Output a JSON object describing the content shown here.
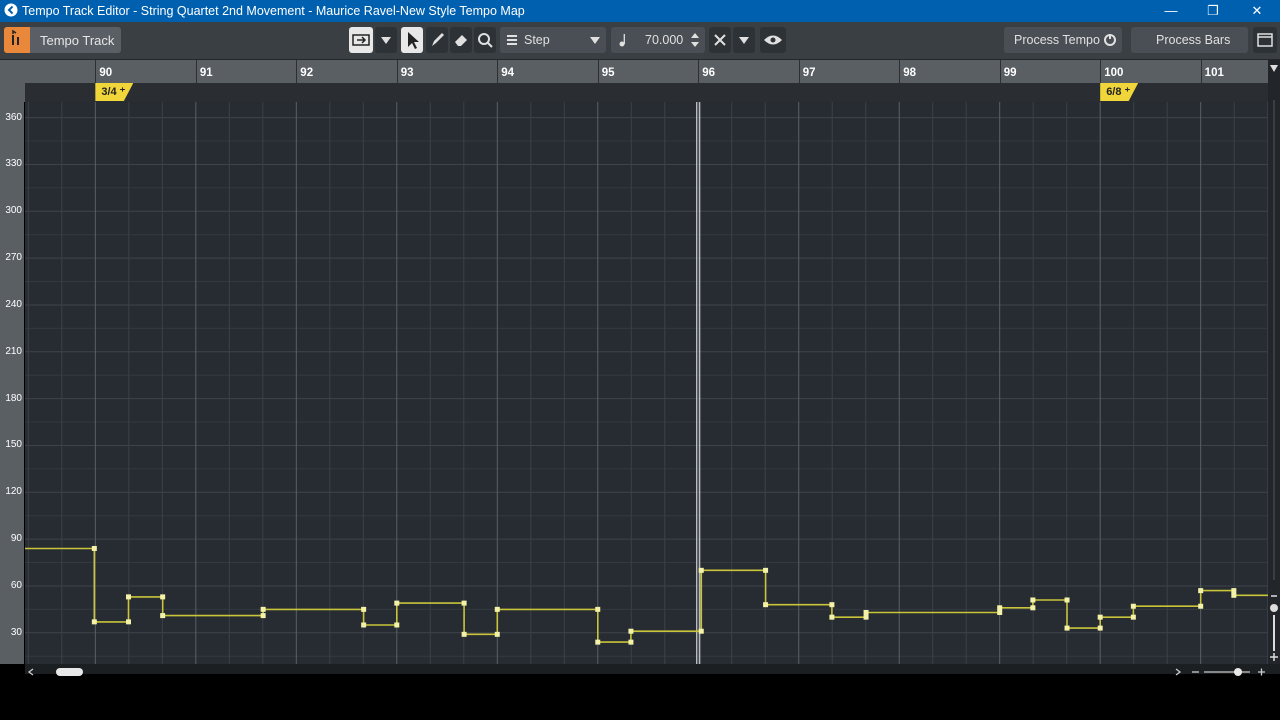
{
  "window": {
    "title": "Tempo Track Editor - String Quartet 2nd Movement - Maurice Ravel-New Style Tempo Map",
    "minimize_glyph": "—",
    "restore_glyph": "❐",
    "close_glyph": "✕"
  },
  "toolbar": {
    "track_label": "Tempo Track",
    "curve_mode": "Step",
    "tempo_value": "70.000",
    "process_tempo_label": "Process Tempo",
    "process_bars_label": "Process Bars"
  },
  "ruler": {
    "bars": [
      "90",
      "91",
      "92",
      "93",
      "94",
      "95",
      "96",
      "97",
      "98",
      "99",
      "100",
      "101"
    ],
    "playhead_bar_label": "96"
  },
  "signatures": [
    {
      "label": "3/4",
      "bar": 90
    },
    {
      "label": "6/8",
      "bar": 100
    }
  ],
  "tempo_scale": {
    "labels": [
      "360",
      "330",
      "300",
      "270",
      "240",
      "210",
      "180",
      "150",
      "120",
      "90",
      "60",
      "30"
    ]
  },
  "chart_data": {
    "type": "line",
    "step": true,
    "x_unit": "bar",
    "y_unit": "bpm",
    "xlim": [
      89.3,
      101.67
    ],
    "ylim": [
      10,
      370
    ],
    "points": [
      [
        89.3,
        84
      ],
      [
        89.99,
        84
      ],
      [
        89.99,
        37
      ],
      [
        90.33,
        37
      ],
      [
        90.33,
        53
      ],
      [
        90.67,
        53
      ],
      [
        90.67,
        41
      ],
      [
        91.0,
        41
      ],
      [
        91.67,
        41
      ],
      [
        91.67,
        45
      ],
      [
        92.0,
        45
      ],
      [
        92.67,
        45
      ],
      [
        92.67,
        35
      ],
      [
        93.0,
        35
      ],
      [
        93.0,
        49
      ],
      [
        93.67,
        49
      ],
      [
        93.67,
        29
      ],
      [
        94.0,
        29
      ],
      [
        94.0,
        45
      ],
      [
        95.0,
        45
      ],
      [
        95.0,
        24
      ],
      [
        95.33,
        24
      ],
      [
        95.33,
        31
      ],
      [
        96.0,
        31
      ],
      [
        96.03,
        31
      ],
      [
        96.03,
        70
      ],
      [
        96.67,
        70
      ],
      [
        96.67,
        48
      ],
      [
        97.0,
        48
      ],
      [
        97.33,
        48
      ],
      [
        97.33,
        40
      ],
      [
        97.67,
        40
      ],
      [
        97.67,
        43
      ],
      [
        98.0,
        43
      ],
      [
        99.0,
        43
      ],
      [
        99.0,
        46
      ],
      [
        99.33,
        46
      ],
      [
        99.33,
        51
      ],
      [
        99.67,
        51
      ],
      [
        99.67,
        33
      ],
      [
        100.0,
        33
      ],
      [
        100.0,
        40
      ],
      [
        100.33,
        40
      ],
      [
        100.33,
        47
      ],
      [
        101.0,
        47
      ],
      [
        101.0,
        57
      ],
      [
        101.33,
        57
      ],
      [
        101.33,
        54
      ],
      [
        101.67,
        54
      ]
    ]
  }
}
